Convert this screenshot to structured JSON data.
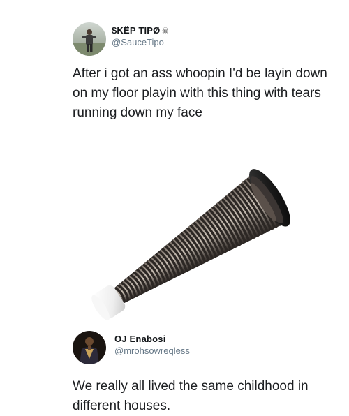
{
  "tweets": [
    {
      "display_name": "$KËP TIPØ",
      "display_emoji": "☠",
      "handle": "@SauceTipo",
      "avatar_icon": "person-photo-avatar",
      "text": "After i got an ass whoopin I'd be layin down on my floor playin with this thing with tears running down my face",
      "media_icon": "spring-door-stopper-image"
    },
    {
      "display_name": "OJ Enabosi",
      "handle": "@mrohsowreqless",
      "avatar_icon": "person-photo-avatar",
      "text": "We really all lived the same childhood in different houses."
    }
  ],
  "colors": {
    "text": "#14171a",
    "handle": "#657786",
    "background": "#ffffff"
  }
}
